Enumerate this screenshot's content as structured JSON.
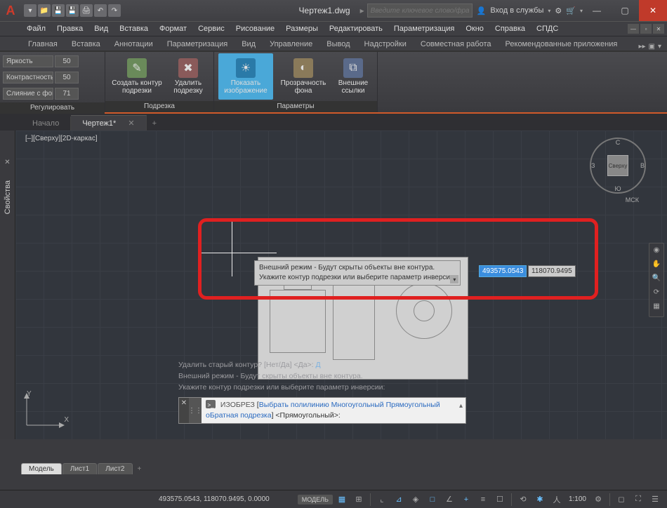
{
  "title": "Чертеж1.dwg",
  "search_placeholder": "Введите ключевое слово/фразу",
  "login_label": "Вход в службы",
  "menu": [
    "Файл",
    "Правка",
    "Вид",
    "Вставка",
    "Формат",
    "Сервис",
    "Рисование",
    "Размеры",
    "Редактировать",
    "Параметризация",
    "Окно",
    "Справка",
    "СПДС"
  ],
  "ribbon_tabs": [
    "Главная",
    "Вставка",
    "Аннотации",
    "Параметризация",
    "Вид",
    "Управление",
    "Вывод",
    "Надстройки",
    "Совместная работа",
    "Рекомендованные приложения"
  ],
  "panels": {
    "adjust": {
      "title": "Регулировать",
      "rows": [
        {
          "label": "Яркость",
          "val": "50"
        },
        {
          "label": "Контрастность",
          "val": "50"
        },
        {
          "label": "Слияние с фон…",
          "val": "71"
        }
      ]
    },
    "clip": {
      "title": "Подрезка",
      "create": "Создать контур подрезки",
      "delete": "Удалить подрезку"
    },
    "options": {
      "title": "Параметры",
      "show": "Показать изображение",
      "transp": "Прозрачность фона",
      "xref": "Внешние ссылки"
    }
  },
  "file_tabs": {
    "start": "Начало",
    "active": "Чертеж1*"
  },
  "viewport_control": "[–][Сверху][2D-каркас]",
  "viewcube": {
    "face": "Сверху",
    "n": "С",
    "s": "Ю",
    "e": "В",
    "w": "З",
    "wcs": "МСК"
  },
  "tooltip": {
    "line1": "Внешний режим - Будут скрыты объекты вне контура.",
    "line2": "Укажите контур подрезки или выберите параметр инверсии:"
  },
  "coords": {
    "x": "493575.0543",
    "y": "118070.9495"
  },
  "ucs": {
    "x": "X",
    "y": "Y"
  },
  "prop_palette": "Свойства",
  "cmd_history": {
    "l1_a": "Удалить старый контур? [Нет/Да] <Да>:",
    "l1_b": "Д",
    "l2": "Внешний режим - Будут скрыты объекты вне контура.",
    "l3": "Укажите контур подрезки или выберите параметр инверсии:"
  },
  "cmdline": {
    "cmd": "ИЗОБРЕЗ",
    "opts_a": "Выбрать полилинию",
    "opts_b": "Многоугольный",
    "opts_c": "Прямоугольный",
    "opts_d": "оБратная подрезка",
    "default": "<Прямоугольный>:"
  },
  "layout_tabs": {
    "model": "Модель",
    "l1": "Лист1",
    "l2": "Лист2"
  },
  "status": {
    "coords": "493575.0543, 118070.9495, 0.0000",
    "model": "МОДЕЛЬ",
    "scale": "1:100"
  }
}
